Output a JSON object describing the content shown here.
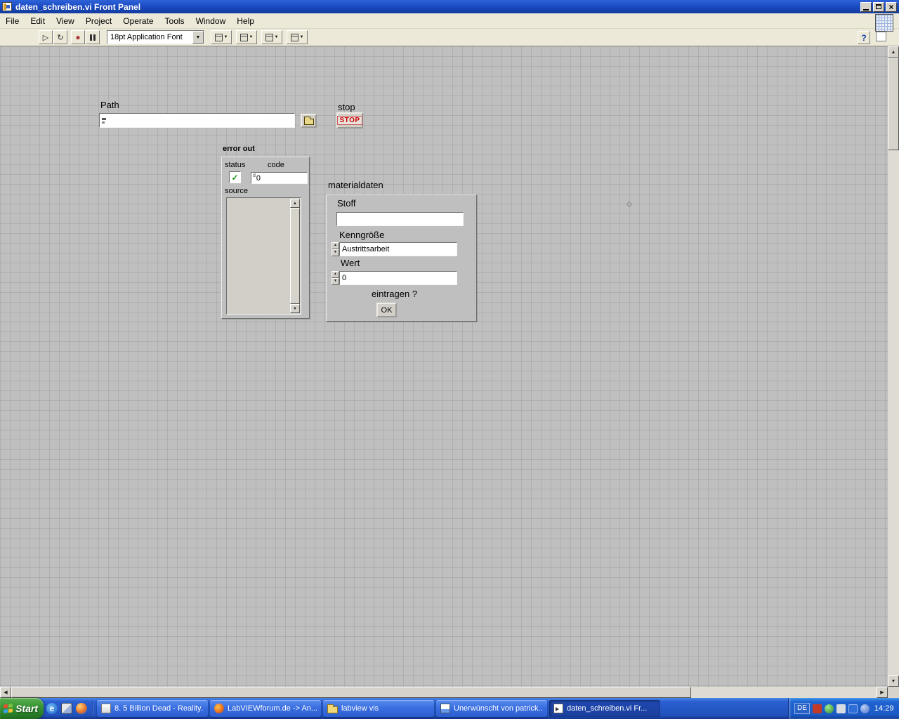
{
  "window": {
    "title": "daten_schreiben.vi Front Panel"
  },
  "menu": {
    "items": [
      "File",
      "Edit",
      "View",
      "Project",
      "Operate",
      "Tools",
      "Window",
      "Help"
    ]
  },
  "toolbar": {
    "font_selector": "18pt Application Font",
    "help_label": "?"
  },
  "icons": {
    "run": "▷",
    "run_continuous": "↻",
    "abort": "●",
    "dropdown": "▼",
    "up": "▲",
    "down": "▼",
    "left": "◀",
    "right": "▶",
    "check": "✓",
    "close": "×",
    "ie": "e"
  },
  "panel": {
    "path": {
      "label": "Path",
      "value": ""
    },
    "stop": {
      "label": "stop",
      "button_label": "STOP"
    },
    "error_out": {
      "title": "error out",
      "status_label": "status",
      "status_symbol": "✓",
      "code_label": "code",
      "code_radix": "d",
      "code_value": "0",
      "source_label": "source",
      "source_value": ""
    },
    "materialdaten": {
      "title": "materialdaten",
      "stoff_label": "Stoff",
      "stoff_value": "",
      "kenngroesse_label": "Kenngröße",
      "kenngroesse_value": "Austrittsarbeit",
      "wert_label": "Wert",
      "wert_value": "0",
      "eintragen_label": "eintragen ?",
      "ok_label": "OK"
    }
  },
  "taskbar": {
    "start_label": "Start",
    "tasks": [
      {
        "label": "8. 5 Billion Dead - Reality..."
      },
      {
        "label": "LabVIEWforum.de -> An..."
      },
      {
        "label": "labview vis"
      },
      {
        "label": "Unerwünscht von patrick..."
      },
      {
        "label": "daten_schreiben.vi Fr..."
      }
    ],
    "tray": {
      "language": "DE",
      "time": "14:29"
    }
  },
  "colors": {
    "titlebar_blue": "#1c4cc4",
    "taskbar_blue": "#2152bc",
    "start_green": "#2e8a2e",
    "stop_text_red": "#cc0000",
    "status_check_green": "#1e8f1e",
    "panel_gray": "#bfbfbf"
  }
}
